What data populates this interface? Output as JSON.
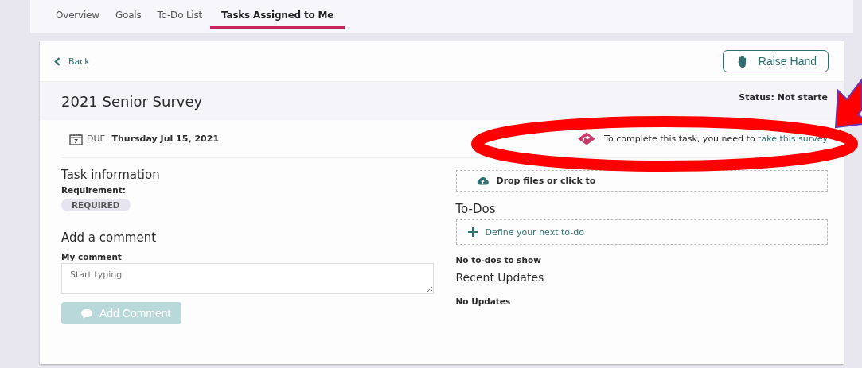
{
  "tabs": [
    {
      "label": "Overview",
      "selected": false
    },
    {
      "label": "Goals",
      "selected": false
    },
    {
      "label": "To-Do List",
      "selected": false
    },
    {
      "label": "Tasks Assigned to Me",
      "selected": true
    }
  ],
  "back": {
    "label": "Back"
  },
  "raise_hand": {
    "label": "Raise Hand"
  },
  "task": {
    "title": "2021 Senior Survey",
    "status": "Status: Not starte",
    "due_label": "DUE",
    "due_date": "Thursday Jul 15, 2021",
    "requirement_prompt": "To complete this task, you need to",
    "requirement_link": "take this survey"
  },
  "task_information": {
    "heading": "Task information",
    "requirement_label": "Requirement:",
    "requirement_badge": "REQUIRED"
  },
  "comment": {
    "heading": "Add a comment",
    "label": "My comment",
    "placeholder": "Start typing",
    "button": "Add Comment",
    "button_disabled": true
  },
  "upload": {
    "text": "Drop files or click to"
  },
  "todos": {
    "heading": "To-Dos",
    "add_label": "Define your next to-do",
    "empty": "No to-dos to show"
  },
  "updates": {
    "heading": "Recent Updates",
    "empty": "No Updates"
  }
}
